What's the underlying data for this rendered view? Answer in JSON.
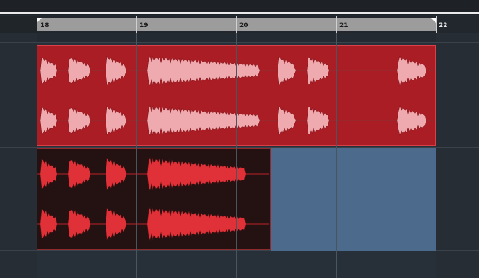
{
  "ruler": {
    "bars": [
      "18",
      "19",
      "20",
      "21",
      "22"
    ]
  },
  "tracks": [
    {
      "name": "",
      "clip_color": "#aa1d24",
      "waveform_color": "#efaab0"
    },
    {
      "name": "",
      "clip_color": "#241112",
      "waveform_color": "#e03138"
    }
  ],
  "colors": {
    "background": "#232a31",
    "selection": "#4b6a8c",
    "ruler_range": "#9c9c9c"
  }
}
